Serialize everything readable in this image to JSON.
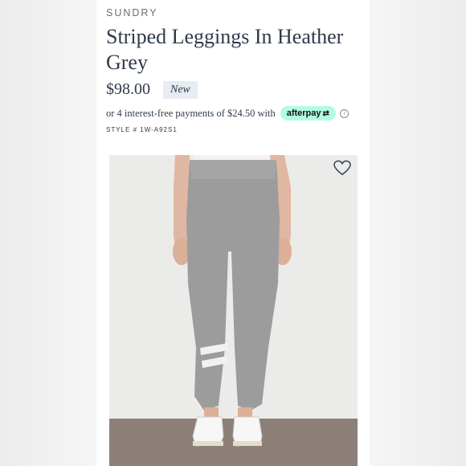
{
  "brand": "SUNDRY",
  "title": "Striped Leggings In Heather Grey",
  "price": "$98.00",
  "badge": "New",
  "afterpay": {
    "text": "or 4 interest-free payments of $24.50 with",
    "logo": "afterpay",
    "info_icon": "info-icon"
  },
  "style_number": "STYLE # 1W-A92S1",
  "photo": {
    "favorite_icon": "heart-icon"
  },
  "colors": {
    "title": "#2f3a4a",
    "badge_bg": "#e7ebf2",
    "afterpay_mint": "#b2fce4",
    "leggings": "#9c9c9c"
  }
}
